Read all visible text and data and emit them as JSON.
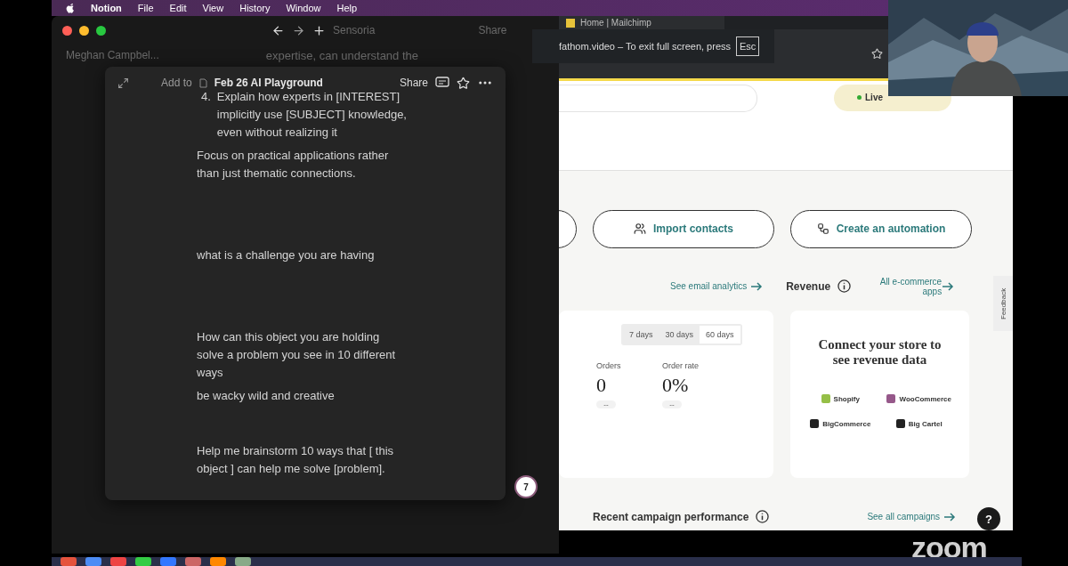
{
  "menubar": {
    "items": [
      {
        "label": "Notion",
        "kind": "app"
      },
      {
        "label": "File",
        "kind": "menu"
      },
      {
        "label": "Edit",
        "kind": "menu"
      },
      {
        "label": "View",
        "kind": "menu"
      },
      {
        "label": "History",
        "kind": "menu"
      },
      {
        "label": "Window",
        "kind": "menu"
      },
      {
        "label": "Help",
        "kind": "menu"
      }
    ]
  },
  "notion": {
    "breadcrumb": "Sensoria",
    "share": "Share",
    "account": "Meghan Campbel...",
    "background_text": "expertise, can understand the",
    "peek": {
      "add_to": "Add to",
      "page_title": "Feb 26 AI Playground",
      "share": "Share",
      "list_item": {
        "number": "4.",
        "text": "Explain how experts in [INTEREST] implicitly use [SUBJECT] knowledge, even without realizing it"
      },
      "paragraphs": [
        {
          "text": "Focus on practical applications rather than just thematic connections."
        },
        {
          "text": "what is a challenge you are having"
        },
        {
          "text": "How can this object you are holding solve a problem you see in 10 different ways"
        },
        {
          "text": "be wacky wild and creative"
        },
        {
          "text": "Help me brainstorm 10 ways that [ this object ] can help me solve [problem]."
        }
      ]
    },
    "badge": "7"
  },
  "browser": {
    "tab_title": "Home | Mailchimp",
    "toast": {
      "text": "fathom.video – To exit full screen, press",
      "key": "Esc"
    },
    "live_help": "Live",
    "actions": [
      "Import contacts",
      "Create an automation"
    ],
    "email_link": "See email analytics",
    "revenue_title": "Revenue",
    "ecommerce_link": "All e-commerce apps",
    "ranges": [
      {
        "label": "7 days",
        "selected": false
      },
      {
        "label": "30 days",
        "selected": false
      },
      {
        "label": "60 days",
        "selected": true
      }
    ],
    "metrics": [
      {
        "label": "Orders",
        "value": "0",
        "change": "--"
      },
      {
        "label": "Order rate",
        "value": "0%",
        "change": "--"
      }
    ],
    "connect_title": "Connect your store to see revenue data",
    "platforms": [
      {
        "name": "Shopify",
        "color": "#95bf47"
      },
      {
        "name": "WooCommerce",
        "color": "#96588a"
      },
      {
        "name": "BigCommerce",
        "color": "#222222"
      },
      {
        "name": "Big Cartel",
        "color": "#222222"
      }
    ],
    "campaigns_title": "Recent campaign performance",
    "campaigns_link": "See all campaigns",
    "feedback": "Feedback",
    "help": "?"
  },
  "zoom_logo": "zoom"
}
